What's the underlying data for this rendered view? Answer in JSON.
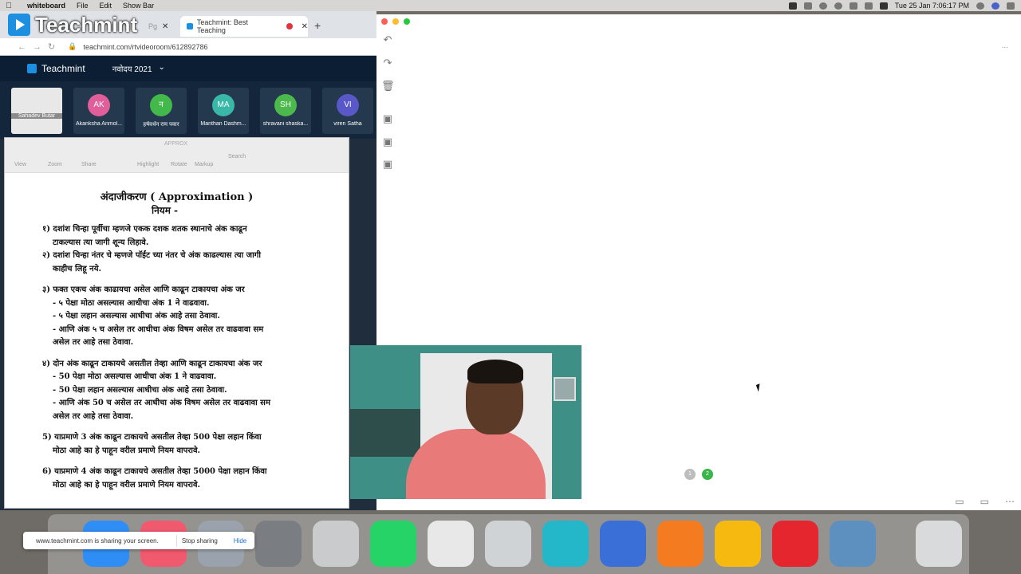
{
  "menubar": {
    "app_name": "whiteboard",
    "items": [
      "File",
      "Edit",
      "Show Bar"
    ],
    "clock": "Tue 25 Jan  7:06:17 PM"
  },
  "browser": {
    "logo_text": "Teachmint",
    "tabs": [
      {
        "label": "Pg"
      },
      {
        "label": "Teachmint: Best Teaching"
      }
    ],
    "url": "teachmint.com/rtvideoroom/612892786",
    "app_brand": "Teachmint",
    "classroom": "नवोदय 2021",
    "participants": [
      {
        "initials": "",
        "name": "Sahadev Butar",
        "color": "#e8e8e8"
      },
      {
        "initials": "AK",
        "name": "Akanksha Anmol...",
        "color": "#e05f9a"
      },
      {
        "initials": "न",
        "name": "हर्षवर्धन राम पवार",
        "color": "#42b94a"
      },
      {
        "initials": "MA",
        "name": "Manthan Dashm...",
        "color": "#39b8a8"
      },
      {
        "initials": "SH",
        "name": "shravani shaska...",
        "color": "#4bb94b"
      },
      {
        "initials": "VI",
        "name": "viren Satha",
        "color": "#5a58c9"
      }
    ]
  },
  "preview": {
    "window_title": "APPROX",
    "toolbar_labels": [
      "View",
      "Zoom",
      "Share",
      "Highlight",
      "Rotate",
      "Markup",
      "Search"
    ],
    "doc_title": "अंदाजीकरण  ( Approximation )",
    "doc_subtitle": "नियम -",
    "rules": [
      {
        "text": "१) दशांश चिन्हा पूर्वीचा म्हणजे एकक दशक शतक स्थानाचे अंक काढून",
        "cls": "rule"
      },
      {
        "text": "टाकल्यास त्या जागी शून्य लिहावे.",
        "cls": "sub"
      },
      {
        "text": "२) दशांश चिन्हा नंतर चे म्हणजे पॉईंट च्या नंतर चे अंक काढल्यास त्या जागी",
        "cls": "rule"
      },
      {
        "text": "काहीच लिहू नये.",
        "cls": "sub"
      },
      {
        "text": "३) फक्त एकच अंक काढायचा असेल आणि काढून टाकायचा अंक जर",
        "cls": "rule gap"
      },
      {
        "text": "- ५ पेक्षा मोठा असल्यास आधीचा अंक 1 ने वाढवावा.",
        "cls": "sub"
      },
      {
        "text": "- ५ पेक्षा लहान असल्यास आधीचा अंक आहे तसा ठेवावा.",
        "cls": "sub"
      },
      {
        "text": "- आणि अंक ५ च असेल तर आधीचा अंक विषम असेल तर वाढवावा सम",
        "cls": "sub"
      },
      {
        "text": "असेल तर आहे तसा ठेवावा.",
        "cls": "sub"
      },
      {
        "text": "४) दोन अंक काढून टाकायचे असतील तेव्हा  आणि काढून टाकायचा अंक जर",
        "cls": "rule gap"
      },
      {
        "text": "- 50 पेक्षा मोठा असल्यास आधीचा अंक 1 ने वाढवावा.",
        "cls": "sub"
      },
      {
        "text": "- 50 पेक्षा लहान असल्यास आधीचा अंक आहे तसा ठेवावा.",
        "cls": "sub"
      },
      {
        "text": "- आणि अंक 50 च असेल तर आधीचा अंक विषम असेल तर वाढवावा सम",
        "cls": "sub"
      },
      {
        "text": "असेल तर आहे तसा ठेवावा.",
        "cls": "sub"
      },
      {
        "text": "5) याप्रमाणे 3 अंक काढून टाकायचे असतील तेव्हा 500 पेक्षा लहान किंवा",
        "cls": "rule gap"
      },
      {
        "text": "मोठा आहे का हे पाहून वरील प्रमाणे नियम वापरावे.",
        "cls": "sub"
      },
      {
        "text": "6) याप्रमाणे 4 अंक काढून टाकायचे असतील तेव्हा 5000 पेक्षा लहान किंवा",
        "cls": "rule gap"
      },
      {
        "text": "मोठा आहे का हे पाहून वरील प्रमाणे नियम वापरावे.",
        "cls": "sub"
      }
    ]
  },
  "whiteboard": {
    "tools": [
      "undo-icon",
      "redo-icon",
      "trash-icon",
      "add-page-icon",
      "copy-page-icon",
      "export-icon"
    ],
    "more_label": "...",
    "pages": [
      {
        "label": "1",
        "color": "#bdbdbd"
      },
      {
        "label": "2",
        "color": "#39b54a"
      }
    ]
  },
  "sharing": {
    "message": "www.teachmint.com is sharing your screen.",
    "stop_label": "Stop sharing",
    "hide_label": "Hide"
  },
  "dock": [
    {
      "name": "finder-icon",
      "color": "#2f8ef5"
    },
    {
      "name": "music-icon",
      "color": "#f15a6e"
    },
    {
      "name": "launchpad-icon",
      "color": "#9aa3ad"
    },
    {
      "name": "system-preferences-icon",
      "color": "#7a7d82"
    },
    {
      "name": "screenshot-icon",
      "color": "#c9cbcd"
    },
    {
      "name": "whatsapp-icon",
      "color": "#25d366"
    },
    {
      "name": "chrome-icon",
      "color": "#e8e8e8"
    },
    {
      "name": "printer-icon",
      "color": "#cfd3d6"
    },
    {
      "name": "whiteboard-app-icon",
      "color": "#24b6c9"
    },
    {
      "name": "teams-like-icon",
      "color": "#3b6fd8"
    },
    {
      "name": "firefox-icon",
      "color": "#f57b20"
    },
    {
      "name": "keynote-icon",
      "color": "#f5b90f"
    },
    {
      "name": "wps-icon",
      "color": "#e6262e"
    },
    {
      "name": "preview-icon",
      "color": "#5d8fbf"
    },
    {
      "name": "trash-icon",
      "color": "#d9dadb"
    }
  ]
}
